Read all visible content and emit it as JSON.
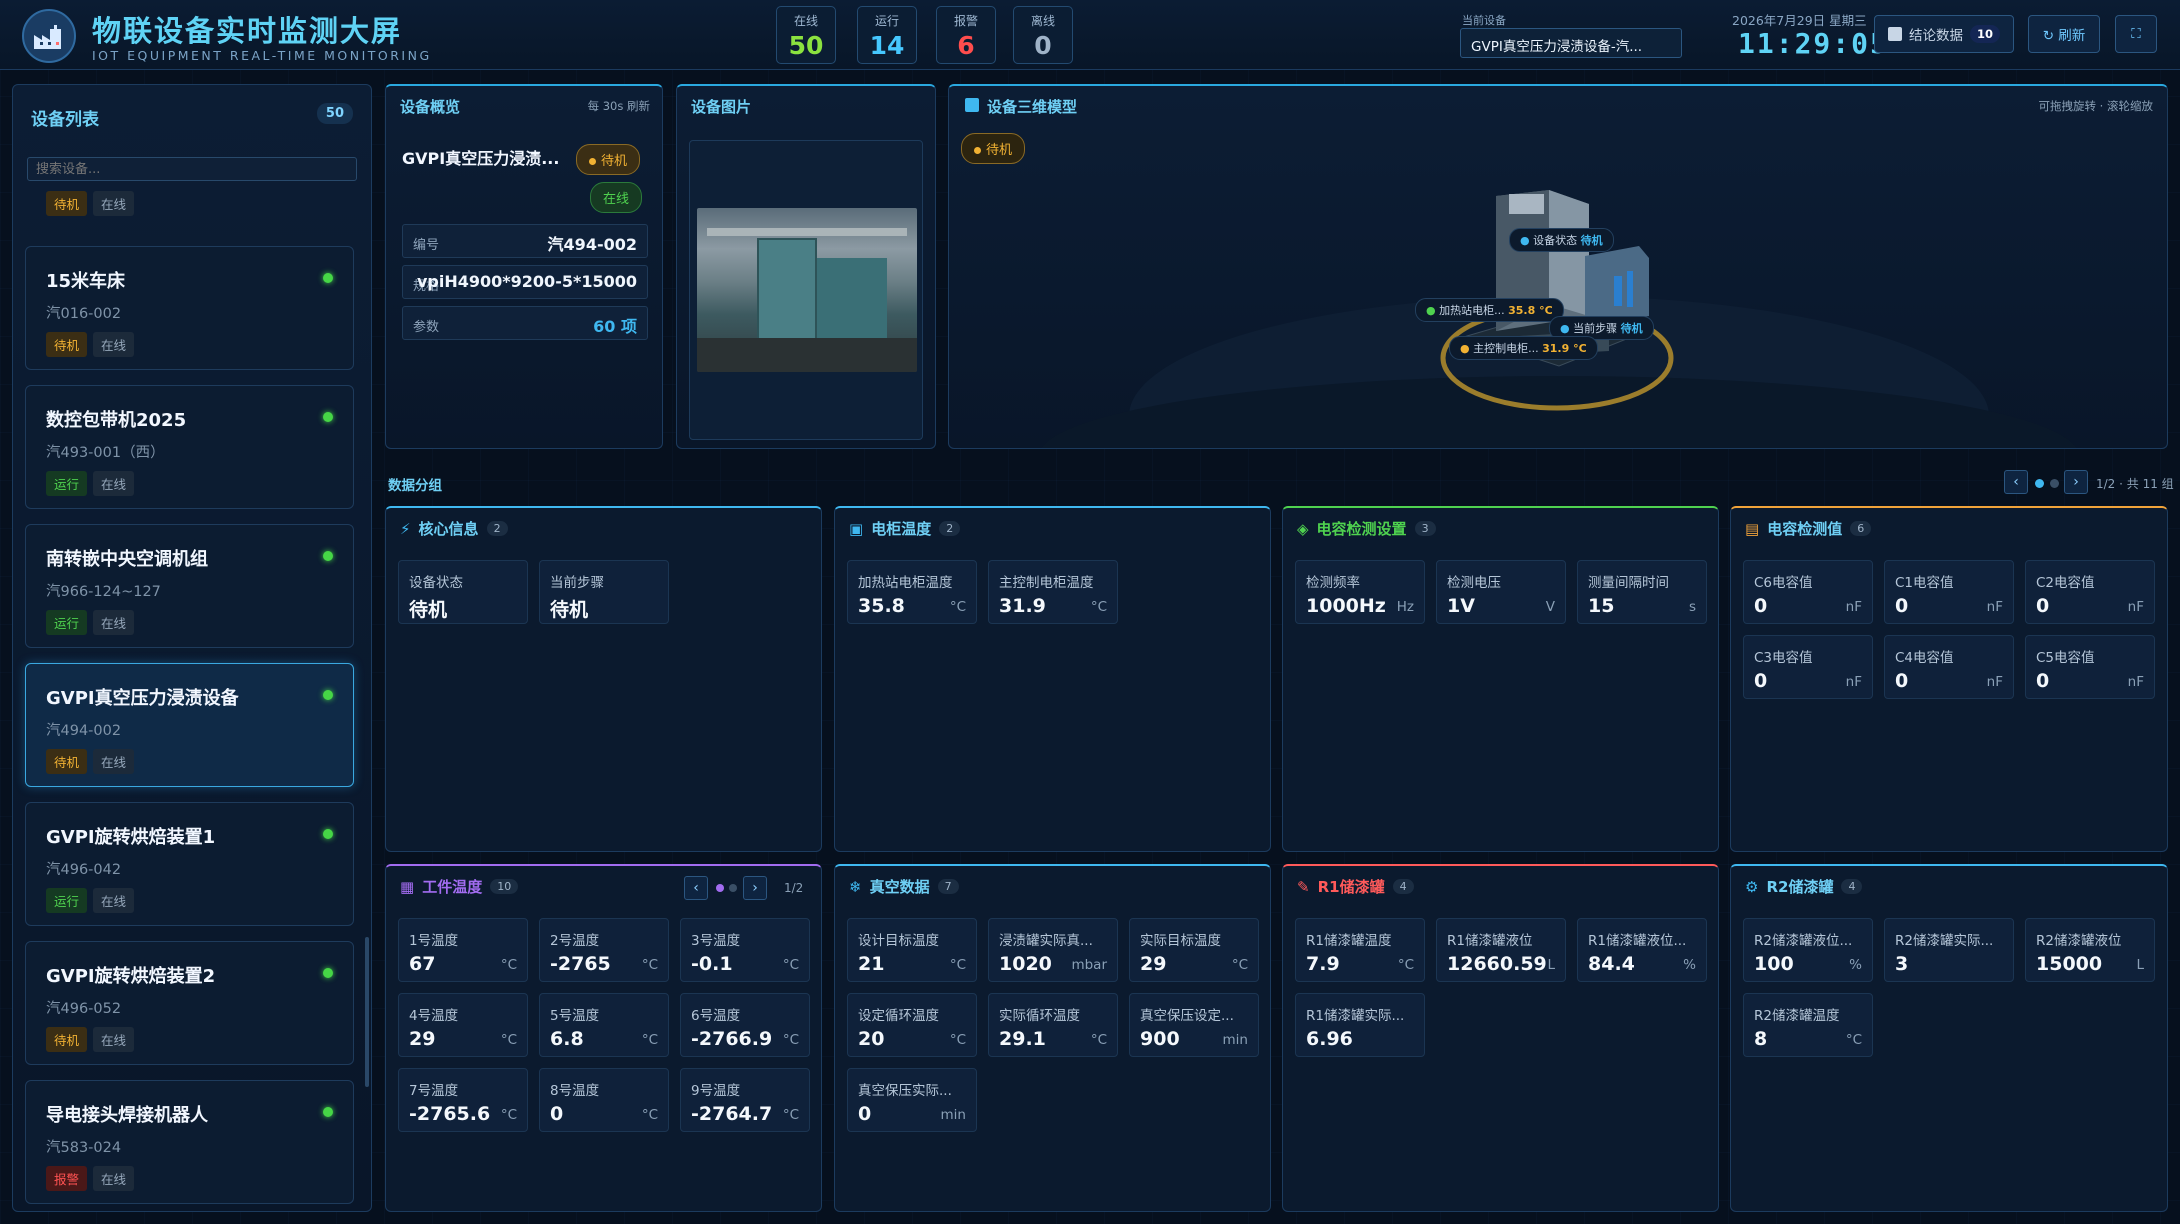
{
  "header": {
    "title": "物联设备实时监测大屏",
    "subtitle": "IOT EQUIPMENT REAL-TIME MONITORING",
    "stats": [
      {
        "label": "在线",
        "value": "50",
        "color": "#8be23f"
      },
      {
        "label": "运行",
        "value": "14",
        "color": "#46c8ff"
      },
      {
        "label": "报警",
        "value": "6",
        "color": "#ff4d4d"
      },
      {
        "label": "离线",
        "value": "0",
        "color": "#9fb3c8"
      }
    ],
    "current_device_label": "当前设备",
    "current_device": "GVPI真空压力浸渍设备-汽...",
    "date": "2026年7月29日 星期三",
    "time": "11:29:05",
    "conclusion_label": "结论数据",
    "conclusion_count": "10",
    "refresh_label": "↻ 刷新"
  },
  "sidebar": {
    "title": "设备列表",
    "count": "50",
    "search_placeholder": "搜索设备...",
    "partial_tags": [
      "待机",
      "在线"
    ],
    "items": [
      {
        "name": "15米车床",
        "code": "汽016-002",
        "status": "待机",
        "status_cls": "standby",
        "online": "在线"
      },
      {
        "name": "数控包带机2025",
        "code": "汽493-001（西）",
        "status": "运行",
        "status_cls": "run",
        "online": "在线"
      },
      {
        "name": "南转嵌中央空调机组",
        "code": "汽966-124~127",
        "status": "运行",
        "status_cls": "run",
        "online": "在线"
      },
      {
        "name": "GVPI真空压力浸渍设备",
        "code": "汽494-002",
        "status": "待机",
        "status_cls": "standby",
        "online": "在线"
      },
      {
        "name": "GVPI旋转烘焙装置1",
        "code": "汽496-042",
        "status": "运行",
        "status_cls": "run",
        "online": "在线"
      },
      {
        "name": "GVPI旋转烘焙装置2",
        "code": "汽496-052",
        "status": "待机",
        "status_cls": "standby",
        "online": "在线"
      },
      {
        "name": "导电接头焊接机器人",
        "code": "汽583-024",
        "status": "报警",
        "status_cls": "alarm",
        "online": "在线"
      }
    ]
  },
  "overview": {
    "title": "设备概览",
    "refresh_hint": "每 30s 刷新",
    "device_name": "GVPI真空压力浸渍...",
    "status": "待机",
    "online": "在线",
    "rows": [
      {
        "key": "编号",
        "value": "汽494-002"
      },
      {
        "key": "规格",
        "value": "vpiH4900*9200-5*15000"
      },
      {
        "key": "参数",
        "value": "60 项"
      }
    ]
  },
  "photo": {
    "title": "设备图片"
  },
  "model3d": {
    "title": "设备三维模型",
    "hint": "可拖拽旋转 · 滚轮缩放",
    "status": "待机",
    "labels": {
      "device_status_k": "设备状态",
      "device_status_v": "待机",
      "heater_k": "加热站电柜...",
      "heater_v": "35.8 °C",
      "step_k": "当前步骤",
      "step_v": "待机",
      "main_k": "主控制电柜...",
      "main_v": "31.9 °C"
    }
  },
  "groups": {
    "title": "数据分组",
    "page_info": "1/2 · 共 11 组",
    "prev": "‹",
    "next": "›"
  },
  "sections": {
    "core": {
      "title": "核心信息",
      "count": "2",
      "color": "#3fb8f0",
      "cells": [
        {
          "n": "设备状态",
          "v": "待机",
          "u": ""
        },
        {
          "n": "当前步骤",
          "v": "待机",
          "u": ""
        }
      ]
    },
    "cabinet": {
      "title": "电柜温度",
      "count": "2",
      "color": "#3fb8f0",
      "cells": [
        {
          "n": "加热站电柜温度",
          "v": "35.8",
          "u": "°C"
        },
        {
          "n": "主控制电柜温度",
          "v": "31.9",
          "u": "°C"
        }
      ]
    },
    "capset": {
      "title": "电容检测设置",
      "count": "3",
      "color": "#4fd24f",
      "cells": [
        {
          "n": "检测频率",
          "v": "1000Hz",
          "u": "Hz"
        },
        {
          "n": "检测电压",
          "v": "1V",
          "u": "V"
        },
        {
          "n": "测量间隔时间",
          "v": "15",
          "u": "s"
        }
      ]
    },
    "capval": {
      "title": "电容检测值",
      "count": "6",
      "color": "#f0a33a",
      "cells": [
        {
          "n": "C6电容值",
          "v": "0",
          "u": "nF"
        },
        {
          "n": "C1电容值",
          "v": "0",
          "u": "nF"
        },
        {
          "n": "C2电容值",
          "v": "0",
          "u": "nF"
        },
        {
          "n": "C3电容值",
          "v": "0",
          "u": "nF"
        },
        {
          "n": "C4电容值",
          "v": "0",
          "u": "nF"
        },
        {
          "n": "C5电容值",
          "v": "0",
          "u": "nF"
        }
      ]
    },
    "work": {
      "title": "工件温度",
      "count": "10",
      "color": "#a26cf0",
      "page": "1/2",
      "cells": [
        {
          "n": "1号温度",
          "v": "67",
          "u": "°C"
        },
        {
          "n": "2号温度",
          "v": "-2765",
          "u": "°C"
        },
        {
          "n": "3号温度",
          "v": "-0.1",
          "u": "°C"
        },
        {
          "n": "4号温度",
          "v": "29",
          "u": "°C"
        },
        {
          "n": "5号温度",
          "v": "6.8",
          "u": "°C"
        },
        {
          "n": "6号温度",
          "v": "-2766.9",
          "u": "°C"
        },
        {
          "n": "7号温度",
          "v": "-2765.6",
          "u": "°C"
        },
        {
          "n": "8号温度",
          "v": "0",
          "u": "°C"
        },
        {
          "n": "9号温度",
          "v": "-2764.7",
          "u": "°C"
        }
      ]
    },
    "vacuum": {
      "title": "真空数据",
      "count": "7",
      "color": "#3fb8f0",
      "cells": [
        {
          "n": "设计目标温度",
          "v": "21",
          "u": "°C"
        },
        {
          "n": "浸渍罐实际真...",
          "v": "1020",
          "u": "mbar"
        },
        {
          "n": "实际目标温度",
          "v": "29",
          "u": "°C"
        },
        {
          "n": "设定循环温度",
          "v": "20",
          "u": "°C"
        },
        {
          "n": "实际循环温度",
          "v": "29.1",
          "u": "°C"
        },
        {
          "n": "真空保压设定...",
          "v": "900",
          "u": "min"
        },
        {
          "n": "真空保压实际...",
          "v": "0",
          "u": "min"
        }
      ]
    },
    "r1": {
      "title": "R1储漆罐",
      "count": "4",
      "color": "#ff5a5a",
      "cells": [
        {
          "n": "R1储漆罐温度",
          "v": "7.9",
          "u": "°C"
        },
        {
          "n": "R1储漆罐液位",
          "v": "12660.59",
          "u": "L"
        },
        {
          "n": "R1储漆罐液位...",
          "v": "84.4",
          "u": "%"
        },
        {
          "n": "R1储漆罐实际...",
          "v": "6.96",
          "u": ""
        }
      ]
    },
    "r2": {
      "title": "R2储漆罐",
      "count": "4",
      "color": "#3fb8f0",
      "cells": [
        {
          "n": "R2储漆罐液位...",
          "v": "100",
          "u": "%"
        },
        {
          "n": "R2储漆罐实际...",
          "v": "3",
          "u": ""
        },
        {
          "n": "R2储漆罐液位",
          "v": "15000",
          "u": "L"
        },
        {
          "n": "R2储漆罐温度",
          "v": "8",
          "u": "°C"
        }
      ]
    }
  }
}
